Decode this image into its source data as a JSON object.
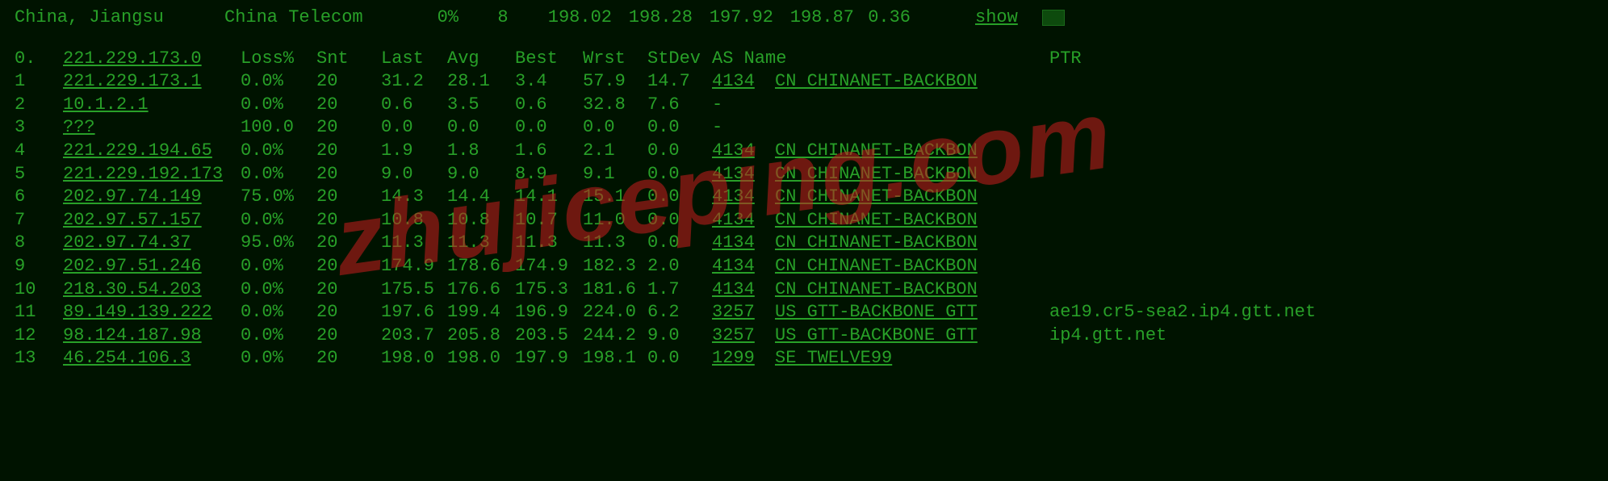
{
  "summary": {
    "location": "China, Jiangsu",
    "isp": "China Telecom",
    "loss_pct": "0%",
    "count": "8",
    "last": "198.02",
    "avg": "198.28",
    "best": "197.92",
    "worst": "198.87",
    "stdev": "0.36",
    "action": "show"
  },
  "headers": {
    "hop": "0.",
    "ip": "221.229.173.0",
    "loss": "Loss%",
    "snt": "Snt",
    "last": "Last",
    "avg": "Avg",
    "best": "Best",
    "wrst": "Wrst",
    "stdev": "StDev",
    "as": "AS Name",
    "ptr": "PTR"
  },
  "hops": [
    {
      "n": "1",
      "ip": "221.229.173.1",
      "loss": "0.0%",
      "snt": "20",
      "last": "31.2",
      "avg": "28.1",
      "best": "3.4",
      "wrst": "57.9",
      "stdev": "14.7",
      "asn": "4134",
      "asname": "CN CHINANET-BACKBON",
      "ptr": ""
    },
    {
      "n": "2",
      "ip": "10.1.2.1",
      "loss": "0.0%",
      "snt": "20",
      "last": "0.6",
      "avg": "3.5",
      "best": "0.6",
      "wrst": "32.8",
      "stdev": "7.6",
      "asn": "-",
      "asname": "",
      "ptr": ""
    },
    {
      "n": "3",
      "ip": "???",
      "loss": "100.0",
      "snt": "20",
      "last": "0.0",
      "avg": "0.0",
      "best": "0.0",
      "wrst": "0.0",
      "stdev": "0.0",
      "asn": "-",
      "asname": "",
      "ptr": ""
    },
    {
      "n": "4",
      "ip": "221.229.194.65",
      "loss": "0.0%",
      "snt": "20",
      "last": "1.9",
      "avg": "1.8",
      "best": "1.6",
      "wrst": "2.1",
      "stdev": "0.0",
      "asn": "4134",
      "asname": "CN CHINANET-BACKBON",
      "ptr": ""
    },
    {
      "n": "5",
      "ip": "221.229.192.173",
      "loss": "0.0%",
      "snt": "20",
      "last": "9.0",
      "avg": "9.0",
      "best": "8.9",
      "wrst": "9.1",
      "stdev": "0.0",
      "asn": "4134",
      "asname": "CN CHINANET-BACKBON",
      "ptr": ""
    },
    {
      "n": "6",
      "ip": "202.97.74.149",
      "loss": "75.0%",
      "snt": "20",
      "last": "14.3",
      "avg": "14.4",
      "best": "14.1",
      "wrst": "15.1",
      "stdev": "0.0",
      "asn": "4134",
      "asname": "CN CHINANET-BACKBON",
      "ptr": ""
    },
    {
      "n": "7",
      "ip": "202.97.57.157",
      "loss": "0.0%",
      "snt": "20",
      "last": "10.8",
      "avg": "10.8",
      "best": "10.7",
      "wrst": "11.0",
      "stdev": "0.0",
      "asn": "4134",
      "asname": "CN CHINANET-BACKBON",
      "ptr": ""
    },
    {
      "n": "8",
      "ip": "202.97.74.37",
      "loss": "95.0%",
      "snt": "20",
      "last": "11.3",
      "avg": "11.3",
      "best": "11.3",
      "wrst": "11.3",
      "stdev": "0.0",
      "asn": "4134",
      "asname": "CN CHINANET-BACKBON",
      "ptr": ""
    },
    {
      "n": "9",
      "ip": "202.97.51.246",
      "loss": "0.0%",
      "snt": "20",
      "last": "174.9",
      "avg": "178.6",
      "best": "174.9",
      "wrst": "182.3",
      "stdev": "2.0",
      "asn": "4134",
      "asname": "CN CHINANET-BACKBON",
      "ptr": ""
    },
    {
      "n": "10",
      "ip": "218.30.54.203",
      "loss": "0.0%",
      "snt": "20",
      "last": "175.5",
      "avg": "176.6",
      "best": "175.3",
      "wrst": "181.6",
      "stdev": "1.7",
      "asn": "4134",
      "asname": "CN CHINANET-BACKBON",
      "ptr": ""
    },
    {
      "n": "11",
      "ip": "89.149.139.222",
      "loss": "0.0%",
      "snt": "20",
      "last": "197.6",
      "avg": "199.4",
      "best": "196.9",
      "wrst": "224.0",
      "stdev": "6.2",
      "asn": "3257",
      "asname": "US GTT-BACKBONE GTT",
      "ptr": "ae19.cr5-sea2.ip4.gtt.net"
    },
    {
      "n": "12",
      "ip": "98.124.187.98",
      "loss": "0.0%",
      "snt": "20",
      "last": "203.7",
      "avg": "205.8",
      "best": "203.5",
      "wrst": "244.2",
      "stdev": "9.0",
      "asn": "3257",
      "asname": "US GTT-BACKBONE GTT",
      "ptr": "ip4.gtt.net"
    },
    {
      "n": "13",
      "ip": "46.254.106.3",
      "loss": "0.0%",
      "snt": "20",
      "last": "198.0",
      "avg": "198.0",
      "best": "197.9",
      "wrst": "198.1",
      "stdev": "0.0",
      "asn": "1299",
      "asname": "SE TWELVE99",
      "ptr": ""
    }
  ],
  "watermark": "zhujiceping.com"
}
